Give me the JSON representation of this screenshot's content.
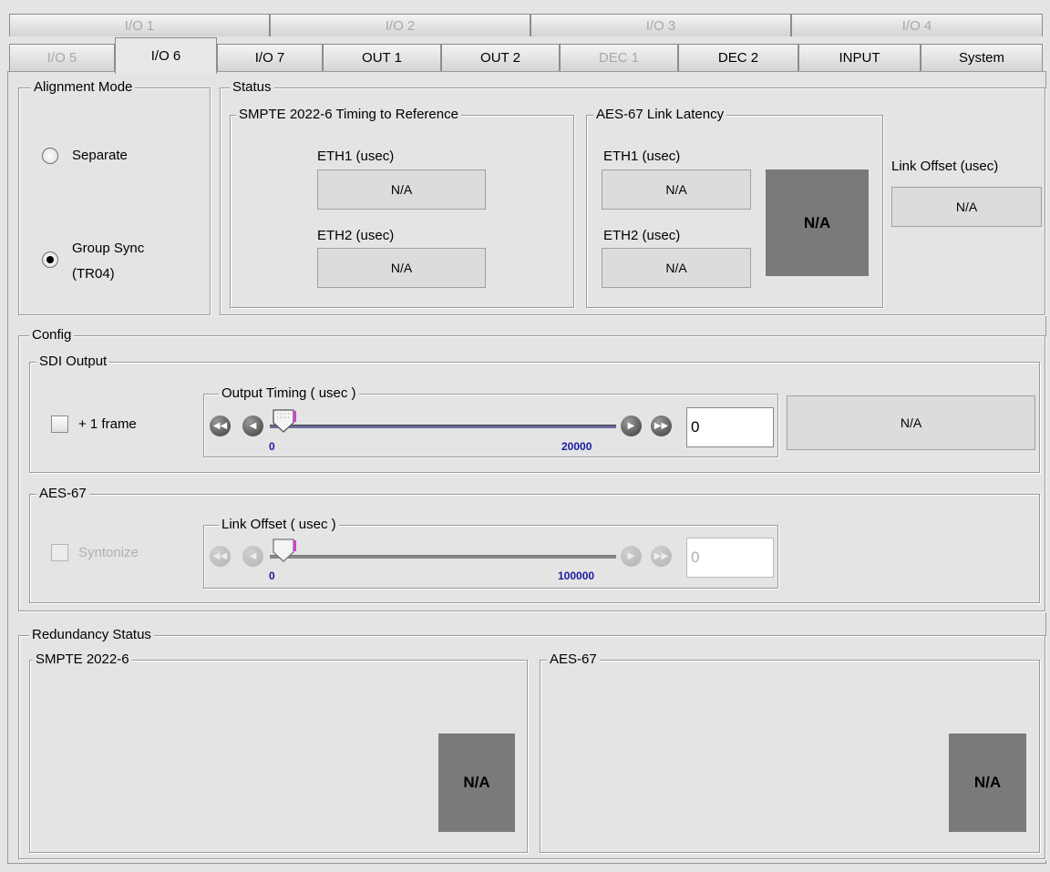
{
  "tabs_row1": [
    {
      "label": "I/O 1",
      "enabled": false
    },
    {
      "label": "I/O 2",
      "enabled": false
    },
    {
      "label": "I/O 3",
      "enabled": false
    },
    {
      "label": "I/O 4",
      "enabled": false
    }
  ],
  "tabs_row2": [
    {
      "label": "I/O 5",
      "enabled": false
    },
    {
      "label": "I/O 6",
      "enabled": true,
      "active": true
    },
    {
      "label": "I/O 7",
      "enabled": true
    },
    {
      "label": "OUT 1",
      "enabled": true
    },
    {
      "label": "OUT 2",
      "enabled": true
    },
    {
      "label": "DEC 1",
      "enabled": false
    },
    {
      "label": "DEC 2",
      "enabled": true
    },
    {
      "label": "INPUT",
      "enabled": true
    },
    {
      "label": "System",
      "enabled": true
    }
  ],
  "alignment": {
    "title": "Alignment Mode",
    "options": [
      {
        "label": "Separate",
        "selected": false
      },
      {
        "label_line1": "Group Sync",
        "label_line2": "(TR04)",
        "selected": true
      }
    ]
  },
  "status": {
    "title": "Status",
    "smpte": {
      "title": "SMPTE 2022-6 Timing to Reference",
      "eth1_label": "ETH1 (usec)",
      "eth1_value": "N/A",
      "eth2_label": "ETH2 (usec)",
      "eth2_value": "N/A"
    },
    "aes": {
      "title": "AES-67 Link Latency",
      "eth1_label": "ETH1 (usec)",
      "eth1_value": "N/A",
      "eth2_label": "ETH2 (usec)",
      "eth2_value": "N/A",
      "indicator": "N/A"
    },
    "link_offset_label": "Link Offset (usec)",
    "link_offset_value": "N/A"
  },
  "config": {
    "title": "Config",
    "sdi": {
      "title": "SDI Output",
      "checkbox_label": "+ 1 frame",
      "checkbox_checked": false,
      "slider_title": "Output Timing ( usec )",
      "min": "0",
      "max": "20000",
      "value": "0",
      "readout": "N/A"
    },
    "aes": {
      "title": "AES-67",
      "checkbox_label": "Syntonize",
      "checkbox_checked": false,
      "slider_title": "Link Offset ( usec )",
      "min": "0",
      "max": "100000",
      "value": "0"
    }
  },
  "redundancy": {
    "title": "Redundancy Status",
    "smpte_title": "SMPTE 2022-6",
    "smpte_value": "N/A",
    "aes_title": "AES-67",
    "aes_value": "N/A"
  },
  "colors": {
    "background": "#e4e4e4",
    "indicator_gray": "#7a7a7a",
    "tick_blue": "#1a1aa0",
    "thumb_marker": "#d040d0"
  }
}
